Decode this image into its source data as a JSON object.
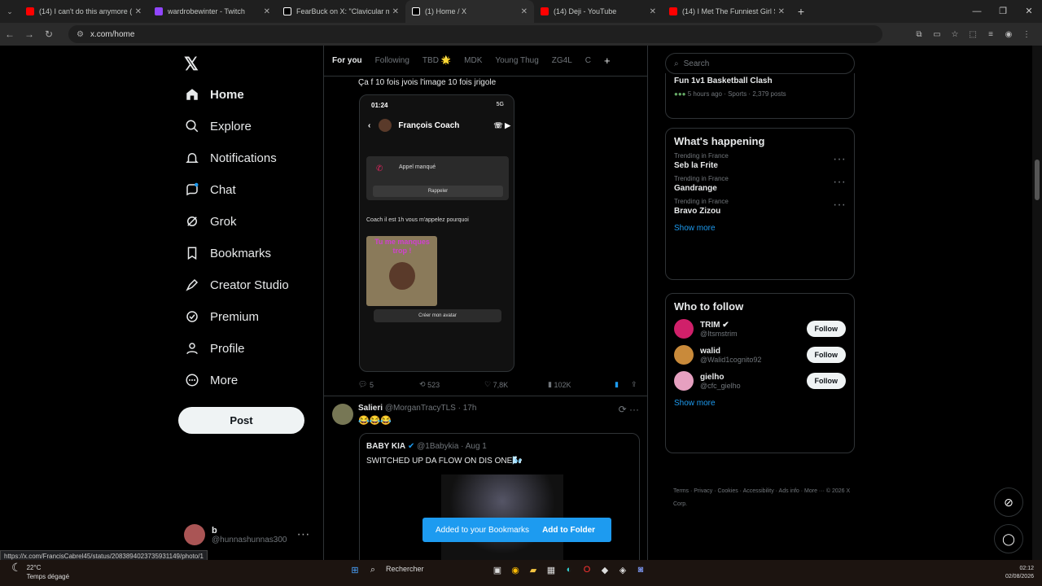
{
  "browser": {
    "tabs": [
      {
        "title": "(14) I can't do this anymore (De",
        "color": "#ff0000"
      },
      {
        "title": "wardrobewinter - Twitch",
        "color": "#9146ff"
      },
      {
        "title": "FearBuck on X: \"Clavicular met",
        "color": "#ffffff"
      },
      {
        "title": "(1) Home / X",
        "color": "#ffffff"
      },
      {
        "title": "(14) Deji - YouTube",
        "color": "#ff0000"
      },
      {
        "title": "(14) I Met The Funniest Girl Stre",
        "color": "#ff0000"
      }
    ],
    "url": "x.com/home",
    "status_url": "https://x.com/FrancisCabrel45/status/2083894023735931149/photo/1"
  },
  "nav": {
    "logo": "𝕏",
    "items": [
      {
        "label": "Home",
        "icon": "home-icon"
      },
      {
        "label": "Explore",
        "icon": "search-icon"
      },
      {
        "label": "Notifications",
        "icon": "bell-icon"
      },
      {
        "label": "Chat",
        "icon": "chat-icon"
      },
      {
        "label": "Grok",
        "icon": "grok-icon"
      },
      {
        "label": "Bookmarks",
        "icon": "bookmark-icon"
      },
      {
        "label": "Creator Studio",
        "icon": "rocket-icon"
      },
      {
        "label": "Premium",
        "icon": "verified-icon"
      },
      {
        "label": "Profile",
        "icon": "person-icon"
      },
      {
        "label": "More",
        "icon": "more-circle-icon"
      }
    ],
    "post_label": "Post",
    "account": {
      "name": "b",
      "handle": "@hunnashunnas300"
    }
  },
  "timeline": {
    "tabs": [
      "For you",
      "Following",
      "TBD 🌟",
      "MDK",
      "Young Thug",
      "ZG4L",
      "C"
    ],
    "tweet1": {
      "text": "Ça f 10 fois jvois l'image 10 fois jrigole",
      "phone": {
        "time": "01:24",
        "signal": "5G",
        "contact": "François Coach",
        "missed": "Appel manqué",
        "recall": "Rappeler",
        "message": "Coach il est 1h vous m'appelez pourquoi",
        "sticker": "Tu me manques trop !",
        "cta": "Créer mon avatar"
      },
      "replies": "5",
      "reposts": "523",
      "likes": "7,8K",
      "views": "102K"
    },
    "tweet2": {
      "name": "Salieri",
      "handle": "@MorganTracyTLS · 17h",
      "text": "😂😂😂",
      "quote_name": "BABY KIA",
      "quote_handle": "@1Babykia · Aug 1",
      "quote_text": "SWITCHED UP DA FLOW ON DIS ONE🌬️"
    }
  },
  "sidebar": {
    "search_placeholder": "Search",
    "top_card": {
      "title": "Fun 1v1 Basketball Clash",
      "meta": "5 hours ago · Sports · 2,379 posts"
    },
    "happening_title": "What's happening",
    "trends": [
      {
        "cat": "Trending in France",
        "name": "Seb la Frite"
      },
      {
        "cat": "Trending in France",
        "name": "Gandrange"
      },
      {
        "cat": "Trending in France",
        "name": "Bravo Zizou"
      }
    ],
    "show_more": "Show more",
    "follow_title": "Who to follow",
    "follow": [
      {
        "name": "TRIM ✔",
        "handle": "@Itsmstrim",
        "btn": "Follow",
        "color": "#d0206a"
      },
      {
        "name": "walid",
        "handle": "@Walid1cognito92",
        "btn": "Follow",
        "color": "#c98a3a"
      },
      {
        "name": "gielho",
        "handle": "@cfc_gielho",
        "btn": "Follow",
        "color": "#e6a0c0"
      }
    ],
    "footer": "Terms · Privacy · Cookies · Accessibility · Ads info · More ··· © 2026 X Corp."
  },
  "toast": {
    "text": "Added to your Bookmarks",
    "action": "Add to Folder"
  },
  "taskbar": {
    "temp": "22°C",
    "weather": "Temps dégagé",
    "search": "Rechercher",
    "time": "02:12",
    "date": "02/08/2026"
  }
}
